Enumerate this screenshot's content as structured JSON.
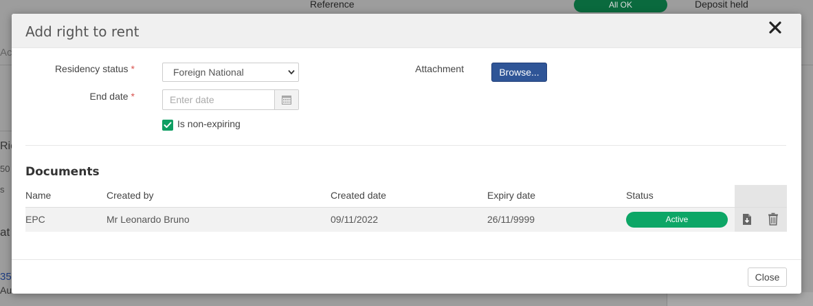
{
  "background": {
    "reference_label": "Reference",
    "status_pill": "All OK",
    "deposit_label": "Deposit held",
    "fragments": [
      "Ac",
      "Ric",
      "50",
      "s",
      "at",
      "35",
      "Au"
    ]
  },
  "modal": {
    "title": "Add right to rent",
    "close_icon": "close-icon",
    "form": {
      "residency_label": "Residency status",
      "residency_value": "Foreign National",
      "end_date_label": "End date",
      "end_date_placeholder": "Enter date",
      "required_marker": "*",
      "non_expiring_label": "Is non-expiring",
      "non_expiring_checked": true,
      "attachment_label": "Attachment",
      "browse_label": "Browse..."
    },
    "documents": {
      "title": "Documents",
      "columns": [
        "Name",
        "Created by",
        "Created date",
        "Expiry date",
        "Status"
      ],
      "rows": [
        {
          "name": "EPC",
          "created_by": "Mr Leonardo Bruno",
          "created_date": "09/11/2022",
          "expiry_date": "26/11/9999",
          "status": "Active"
        }
      ]
    },
    "footer": {
      "close_label": "Close"
    }
  },
  "colors": {
    "accent_green": "#0da666",
    "browse_blue": "#2f5597",
    "required_red": "#d9534f"
  }
}
